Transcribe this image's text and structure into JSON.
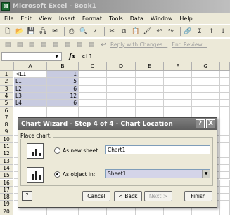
{
  "window": {
    "title": "Microsoft Excel - Book1",
    "app_icon": "excel-icon"
  },
  "menu": [
    "File",
    "Edit",
    "View",
    "Insert",
    "Format",
    "Tools",
    "Data",
    "Window",
    "Help"
  ],
  "toolbar2": {
    "reply": "Reply with Changes...",
    "end_review": "End Review..."
  },
  "formula": {
    "namebox": "",
    "fx": "fx",
    "value": "<L1"
  },
  "columns": [
    "A",
    "B",
    "C",
    "D",
    "E",
    "F",
    "G"
  ],
  "rows": [
    "1",
    "2",
    "3",
    "4",
    "5",
    "6",
    "7",
    "8",
    "9",
    "10",
    "11",
    "12",
    "13",
    "14",
    "15",
    "16",
    "17",
    "18",
    "19",
    "20"
  ],
  "cells": [
    {
      "a": "<L1",
      "b": "1"
    },
    {
      "a": "L1",
      "b": "5"
    },
    {
      "a": "L2",
      "b": "6"
    },
    {
      "a": "L3",
      "b": "12"
    },
    {
      "a": "L4",
      "b": "6"
    }
  ],
  "dialog": {
    "title": "Chart Wizard - Step 4 of 4 - Chart Location",
    "help_glyph": "?",
    "close_glyph": "X",
    "place_label": "Place chart:",
    "new_sheet_label": "As new sheet:",
    "new_sheet_value": "Chart1",
    "object_in_label": "As object in:",
    "object_in_value": "Sheet1",
    "buttons": {
      "cancel": "Cancel",
      "back": "< Back",
      "next": "Next >",
      "finish": "Finish"
    },
    "help_button": "?"
  }
}
